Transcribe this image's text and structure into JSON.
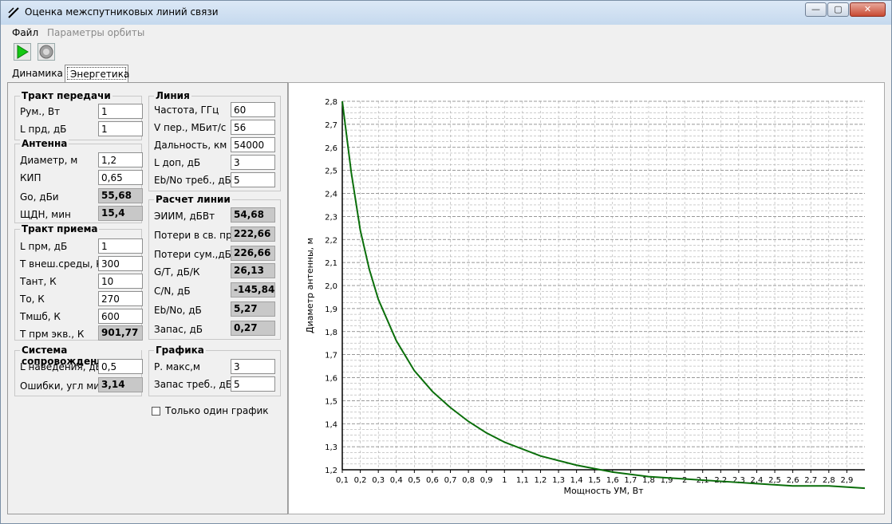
{
  "window": {
    "title": "Оценка межспутниковых линий связи",
    "minimize": "—",
    "maximize": "▢",
    "close": "✕"
  },
  "menu": {
    "file": "Файл",
    "orbit_params": "Параметры орбиты"
  },
  "toolbar": {
    "run_icon": "play-icon",
    "stop_icon": "stop-icon"
  },
  "tabs": {
    "dynamics": "Динамика",
    "energy": "Энергетика"
  },
  "tx": {
    "title": "Тракт передачи",
    "rum_label": "Рум., Вт",
    "rum_value": "1",
    "lprd_label": "L прд, дБ",
    "lprd_value": "1"
  },
  "antenna": {
    "title": "Антенна",
    "diam_label": "Диаметр, м",
    "diam_value": "1,2",
    "kip_label": "КИП",
    "kip_value": "0,65",
    "go_label": "Go, дБи",
    "go_value": "55,68",
    "shdn_label": "ЩДН, мин",
    "shdn_value": "15,4"
  },
  "rx": {
    "title": "Тракт приема",
    "lprm_label": "L прм, дБ",
    "lprm_value": "1",
    "tenv_label": "Т внеш.среды, К",
    "tenv_value": "300",
    "tant_label": "Тант, К",
    "tant_value": "10",
    "to_label": "То, К",
    "to_value": "270",
    "tmshb_label": "Тмшб, К",
    "tmshb_value": "600",
    "tprm_label": "Т прм экв., К",
    "tprm_value": "901,77"
  },
  "tracking": {
    "title": "Система сопровождения",
    "lnav_label": "L наведения, дБ",
    "lnav_value": "0,5",
    "err_label": "Ошибки, угл мин",
    "err_value": "3,14"
  },
  "line": {
    "title": "Линия",
    "freq_label": "Частота, ГГц",
    "freq_value": "60",
    "vper_label": "V пер., МБит/с",
    "vper_value": "56",
    "dist_label": "Дальность, км",
    "dist_value": "54000",
    "ldop_label": "L доп, дБ",
    "ldop_value": "3",
    "ebno_req_label": "Eb/No треб., дБ",
    "ebno_req_value": "5"
  },
  "calc": {
    "title": "Расчет линии",
    "eirp_label": "ЭИИМ, дБВт",
    "eirp_value": "54,68",
    "fsl_label": "Потери в св. пр.",
    "fsl_value": "222,66",
    "ltot_label": "Потери сум.,дБ",
    "ltot_value": "226,66",
    "gt_label": "G/T, дБ/К",
    "gt_value": "26,13",
    "cn_label": "C/N, дБ",
    "cn_value": "-145,84",
    "ebno_label": "Eb/No, дБ",
    "ebno_value": "5,27",
    "margin_label": "Запас, дБ",
    "margin_value": "0,27"
  },
  "graph_settings": {
    "title": "Графика",
    "pmax_label": "Р. макс,м",
    "pmax_value": "3",
    "margin_req_label": "Запас треб., дБ",
    "margin_req_value": "5"
  },
  "single_graph_label": "Только один график",
  "colors": {
    "curve": "#0a6e0a",
    "grid": "#9a9a9a"
  },
  "chart_data": {
    "type": "line",
    "xlabel": "Мощность УМ, Вт",
    "ylabel": "Диаметр антенны, м",
    "xlim": [
      0.1,
      3.0
    ],
    "ylim": [
      1.2,
      2.8
    ],
    "x_ticks": [
      "0,1",
      "0,2",
      "0,3",
      "0,4",
      "0,5",
      "0,6",
      "0,7",
      "0,8",
      "0,9",
      "1",
      "1,1",
      "1,2",
      "1,3",
      "1,4",
      "1,5",
      "1,6",
      "1,7",
      "1,8",
      "1,9",
      "2",
      "2,1",
      "2,2",
      "2,3",
      "2,4",
      "2,5",
      "2,6",
      "2,7",
      "2,8",
      "2,9"
    ],
    "y_ticks": [
      "1,2",
      "1,3",
      "1,4",
      "1,5",
      "1,6",
      "1,7",
      "1,8",
      "1,9",
      "2,0",
      "2,1",
      "2,2",
      "2,3",
      "2,4",
      "2,5",
      "2,6",
      "2,7",
      "2,8"
    ],
    "series": [
      {
        "x": [
          0.1,
          0.15,
          0.2,
          0.25,
          0.3,
          0.4,
          0.5,
          0.6,
          0.7,
          0.8,
          0.9,
          1.0,
          1.2,
          1.4,
          1.6,
          1.8,
          2.0,
          2.2,
          2.4,
          2.6,
          2.8,
          3.0
        ],
        "y": [
          2.8,
          2.49,
          2.24,
          2.07,
          1.94,
          1.76,
          1.63,
          1.54,
          1.47,
          1.41,
          1.36,
          1.32,
          1.26,
          1.22,
          1.19,
          1.17,
          1.16,
          1.15,
          1.14,
          1.13,
          1.13,
          1.12
        ]
      }
    ]
  }
}
